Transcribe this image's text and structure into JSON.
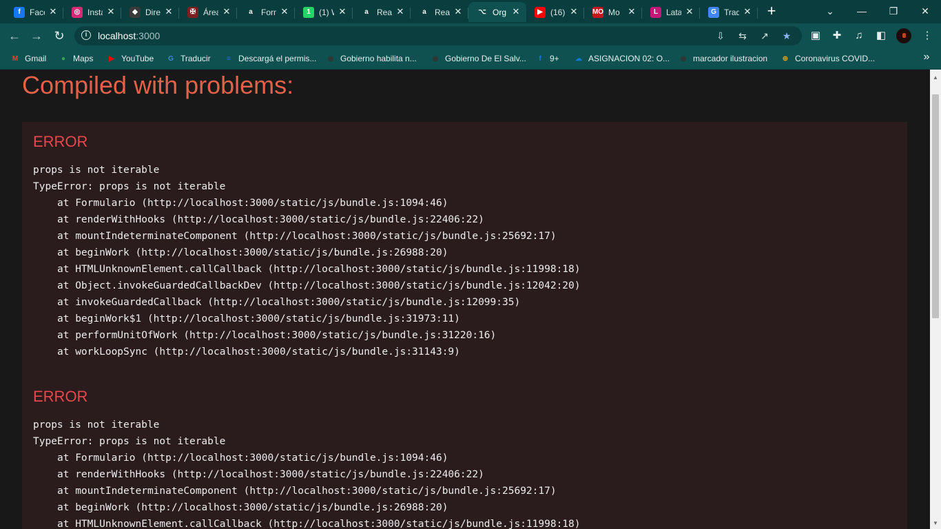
{
  "browser": {
    "tabs": [
      {
        "title": "Face",
        "favicon": "facebook-icon",
        "color": "#1877f2",
        "glyph": "f"
      },
      {
        "title": "Insta",
        "favicon": "instagram-icon",
        "color": "#d62976",
        "glyph": "◎"
      },
      {
        "title": "Direc",
        "favicon": "direct-icon",
        "color": "#3a3a3a",
        "glyph": "◆"
      },
      {
        "title": "Área",
        "favicon": "crest-icon",
        "color": "#7a1f1f",
        "glyph": "✠"
      },
      {
        "title": "Form",
        "favicon": "amino-icon",
        "color": "#0a3d3d",
        "glyph": "a"
      },
      {
        "title": "(1) W",
        "favicon": "whatsapp-icon",
        "color": "#25d366",
        "glyph": "1"
      },
      {
        "title": "Rea",
        "favicon": "amino-icon",
        "color": "#0a3d3d",
        "glyph": "a"
      },
      {
        "title": "Rea",
        "favicon": "amino-icon",
        "color": "#0a3d3d",
        "glyph": "a"
      },
      {
        "title": "Org",
        "favicon": "organization-icon",
        "color": "#0f5050",
        "glyph": "⌥"
      },
      {
        "title": "(16)",
        "favicon": "youtube-icon",
        "color": "#ff0000",
        "glyph": "▶"
      },
      {
        "title": "Mo",
        "favicon": "mo-icon",
        "color": "#c4161c",
        "glyph": "MO"
      },
      {
        "title": "Lata",
        "favicon": "latam-icon",
        "color": "#c2187a",
        "glyph": "L"
      },
      {
        "title": "Trad",
        "favicon": "translate-icon",
        "color": "#4285f4",
        "glyph": "G"
      }
    ],
    "active_tab_index": 8,
    "close_glyph": "✕",
    "new_tab_glyph": "+",
    "window_controls": [
      "⌄",
      "—",
      "❐",
      "✕"
    ],
    "url_host": "localhost",
    "url_port": ":3000"
  },
  "bookmarks": [
    {
      "label": "Gmail",
      "icon": "gmail-icon",
      "color": "#ea4335",
      "glyph": "M"
    },
    {
      "label": "Maps",
      "icon": "maps-icon",
      "color": "#34a853",
      "glyph": "●"
    },
    {
      "label": "YouTube",
      "icon": "youtube-icon",
      "color": "#ff0000",
      "glyph": "▶"
    },
    {
      "label": "Traducir",
      "icon": "translate-icon",
      "color": "#4285f4",
      "glyph": "G"
    },
    {
      "label": "Descargá el permis...",
      "icon": "doc-icon",
      "color": "#2a6ed6",
      "glyph": "≡"
    },
    {
      "label": "Gobierno habilita n...",
      "icon": "globe-icon",
      "color": "#333333",
      "glyph": "◉"
    },
    {
      "label": "Gobierno De El Salv...",
      "icon": "globe-icon",
      "color": "#333333",
      "glyph": "◉"
    },
    {
      "label": "9+",
      "icon": "facebook-icon",
      "color": "#1877f2",
      "glyph": "f"
    },
    {
      "label": "ASIGNACION 02: O...",
      "icon": "onedrive-icon",
      "color": "#0f78d4",
      "glyph": "☁"
    },
    {
      "label": "marcador ilustracion",
      "icon": "globe-icon",
      "color": "#333333",
      "glyph": "◉"
    },
    {
      "label": "Coronavirus COVID...",
      "icon": "covid-icon",
      "color": "#d4a017",
      "glyph": "⊕"
    }
  ],
  "page": {
    "title": "Compiled with problems:",
    "errors": [
      {
        "heading": "ERROR",
        "message": "props is not iterable",
        "type_line": "TypeError: props is not iterable",
        "frames": [
          "at Formulario (http://localhost:3000/static/js/bundle.js:1094:46)",
          "at renderWithHooks (http://localhost:3000/static/js/bundle.js:22406:22)",
          "at mountIndeterminateComponent (http://localhost:3000/static/js/bundle.js:25692:17)",
          "at beginWork (http://localhost:3000/static/js/bundle.js:26988:20)",
          "at HTMLUnknownElement.callCallback (http://localhost:3000/static/js/bundle.js:11998:18)",
          "at Object.invokeGuardedCallbackDev (http://localhost:3000/static/js/bundle.js:12042:20)",
          "at invokeGuardedCallback (http://localhost:3000/static/js/bundle.js:12099:35)",
          "at beginWork$1 (http://localhost:3000/static/js/bundle.js:31973:11)",
          "at performUnitOfWork (http://localhost:3000/static/js/bundle.js:31220:16)",
          "at workLoopSync (http://localhost:3000/static/js/bundle.js:31143:9)"
        ]
      },
      {
        "heading": "ERROR",
        "message": "props is not iterable",
        "type_line": "TypeError: props is not iterable",
        "frames": [
          "at Formulario (http://localhost:3000/static/js/bundle.js:1094:46)",
          "at renderWithHooks (http://localhost:3000/static/js/bundle.js:22406:22)",
          "at mountIndeterminateComponent (http://localhost:3000/static/js/bundle.js:25692:17)",
          "at beginWork (http://localhost:3000/static/js/bundle.js:26988:20)",
          "at HTMLUnknownElement.callCallback (http://localhost:3000/static/js/bundle.js:11998:18)"
        ]
      }
    ]
  },
  "colors": {
    "title": "#e36049",
    "error_heading": "#e8474d",
    "panel_bg": "#2a1b1d",
    "chrome_bg": "#0f5050"
  }
}
